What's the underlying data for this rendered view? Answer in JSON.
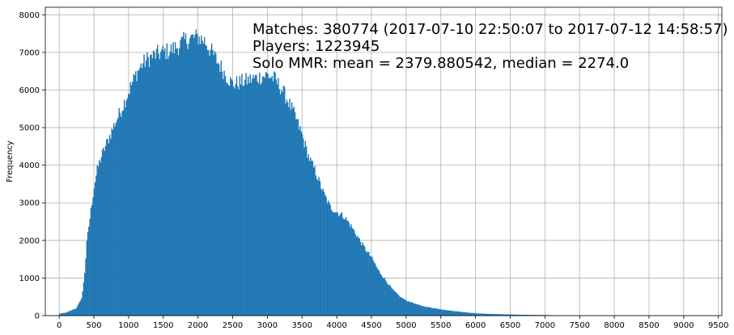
{
  "chart_data": {
    "type": "bar",
    "title": "",
    "xlabel": "",
    "ylabel": "Frequency",
    "xlim": [
      -200,
      9550
    ],
    "ylim": [
      0,
      8200
    ],
    "bin_width": 15,
    "xticks": [
      0,
      500,
      1000,
      1500,
      2000,
      2500,
      3000,
      3500,
      4000,
      4500,
      5000,
      5500,
      6000,
      6500,
      7000,
      7500,
      8000,
      8500,
      9000,
      9500
    ],
    "yticks": [
      0,
      1000,
      2000,
      3000,
      4000,
      5000,
      6000,
      7000,
      8000
    ],
    "grid": true,
    "bar_color": "#1f77b4",
    "annotations": [
      "Matches: 380774 (2017-07-10 22:50:07 to 2017-07-12 14:58:57)",
      "Players: 1223945",
      "Solo MMR: mean = 2379.880542, median = 2274.0"
    ],
    "profile": {
      "x": [
        0,
        100,
        250,
        330,
        370,
        400,
        450,
        500,
        550,
        600,
        700,
        800,
        900,
        1000,
        1100,
        1200,
        1300,
        1400,
        1500,
        1600,
        1700,
        1800,
        1900,
        2000,
        2100,
        2200,
        2300,
        2400,
        2500,
        2600,
        2700,
        2800,
        2900,
        3000,
        3100,
        3200,
        3300,
        3400,
        3500,
        3600,
        3700,
        3800,
        3900,
        4000,
        4100,
        4200,
        4300,
        4400,
        4500,
        4600,
        4700,
        4800,
        4900,
        5000,
        5100,
        5200,
        5300,
        5400,
        5500,
        5600,
        5700,
        5800,
        5900,
        6000,
        6200,
        6400,
        6600,
        6800,
        7000,
        7200,
        7400,
        7500
      ],
      "y": [
        50,
        80,
        200,
        500,
        1200,
        2000,
        2700,
        3400,
        3900,
        4200,
        4650,
        5100,
        5500,
        5950,
        6400,
        6700,
        6850,
        6950,
        7000,
        7050,
        7150,
        7300,
        7380,
        7400,
        7300,
        7000,
        6700,
        6400,
        6150,
        6200,
        6250,
        6300,
        6350,
        6400,
        6300,
        6050,
        5700,
        5300,
        4800,
        4200,
        3800,
        3300,
        2900,
        2750,
        2650,
        2400,
        2100,
        1800,
        1550,
        1200,
        950,
        700,
        520,
        400,
        340,
        270,
        230,
        200,
        170,
        140,
        120,
        100,
        80,
        60,
        45,
        35,
        25,
        20,
        15,
        8,
        3,
        0
      ]
    }
  }
}
